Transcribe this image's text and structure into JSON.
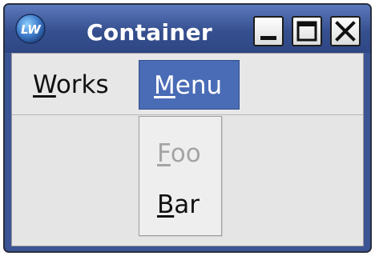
{
  "window": {
    "title": "Container",
    "app_icon": "lw-logo-icon",
    "controls": {
      "minimize": "minimize-icon",
      "maximize": "maximize-icon",
      "close": "close-icon"
    }
  },
  "menubar": {
    "items": [
      {
        "mnemonic": "W",
        "rest": "orks",
        "state": "normal"
      },
      {
        "mnemonic": "M",
        "rest": "enu",
        "state": "open"
      }
    ]
  },
  "dropdown": {
    "items": [
      {
        "mnemonic": "F",
        "rest": "oo",
        "enabled": false
      },
      {
        "mnemonic": "B",
        "rest": "ar",
        "enabled": true
      }
    ]
  },
  "colors": {
    "titlebar": "#3b5494",
    "menu_highlight": "#4a6cb6",
    "client_bg": "#e5e5e5",
    "disabled_text": "#a4a4a4"
  }
}
